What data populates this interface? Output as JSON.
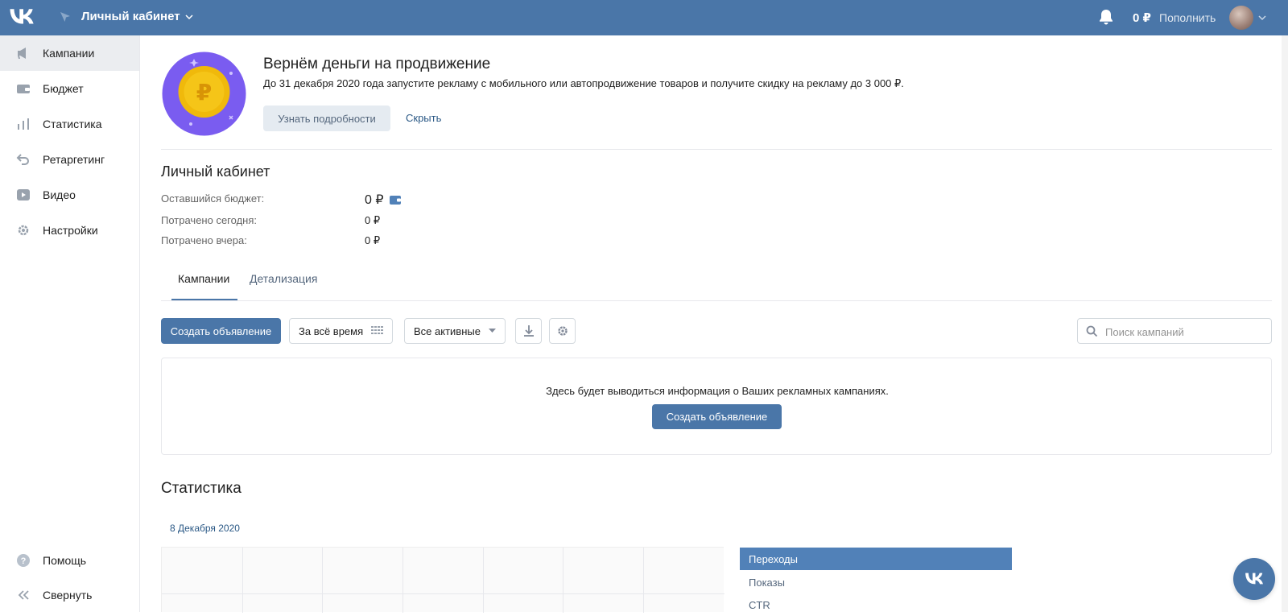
{
  "header": {
    "title": "Личный кабинет",
    "balance": "0 ₽",
    "topup_label": "Пополнить"
  },
  "sidebar": {
    "items": [
      {
        "label": "Кампании",
        "icon": "megaphone-icon"
      },
      {
        "label": "Бюджет",
        "icon": "wallet-icon"
      },
      {
        "label": "Статистика",
        "icon": "bar-chart-icon"
      },
      {
        "label": "Ретаргетинг",
        "icon": "return-arrow-icon"
      },
      {
        "label": "Видео",
        "icon": "play-icon"
      },
      {
        "label": "Настройки",
        "icon": "gear-icon"
      }
    ],
    "help_label": "Помощь",
    "collapse_label": "Свернуть"
  },
  "promo": {
    "title": "Вернём деньги на продвижение",
    "text": "До 31 декабря 2020 года запустите рекламу с мобильного или автопродвижение товаров и получите скидку на рекламу до 3 000 ₽.",
    "more_label": "Узнать подробности",
    "hide_label": "Скрыть"
  },
  "cabinet": {
    "title": "Личный кабинет",
    "rows": [
      {
        "label": "Оставшийся бюджет:",
        "value": "0 ₽"
      },
      {
        "label": "Потрачено сегодня:",
        "value": "0 ₽"
      },
      {
        "label": "Потрачено вчера:",
        "value": "0 ₽"
      }
    ]
  },
  "tabs": [
    {
      "label": "Кампании",
      "active": true
    },
    {
      "label": "Детализация",
      "active": false
    }
  ],
  "toolbar": {
    "create_label": "Создать объявление",
    "period_label": "За всё время",
    "status_label": "Все активные",
    "search_placeholder": "Поиск кампаний"
  },
  "empty_state": {
    "text": "Здесь будет выводиться информация о Ваших рекламных кампаниях.",
    "create_label": "Создать объявление"
  },
  "stats": {
    "title": "Статистика",
    "date": "8 Декабря 2020",
    "metrics": [
      {
        "label": "Переходы",
        "active": true
      },
      {
        "label": "Показы",
        "active": false
      },
      {
        "label": "CTR",
        "active": false
      }
    ]
  },
  "colors": {
    "brand": "#4a76a8",
    "sidebar_active": "#ebedf0",
    "metric_active": "#5181b8",
    "coin_bg": "#7a5cf0",
    "coin": "#f5c518"
  }
}
